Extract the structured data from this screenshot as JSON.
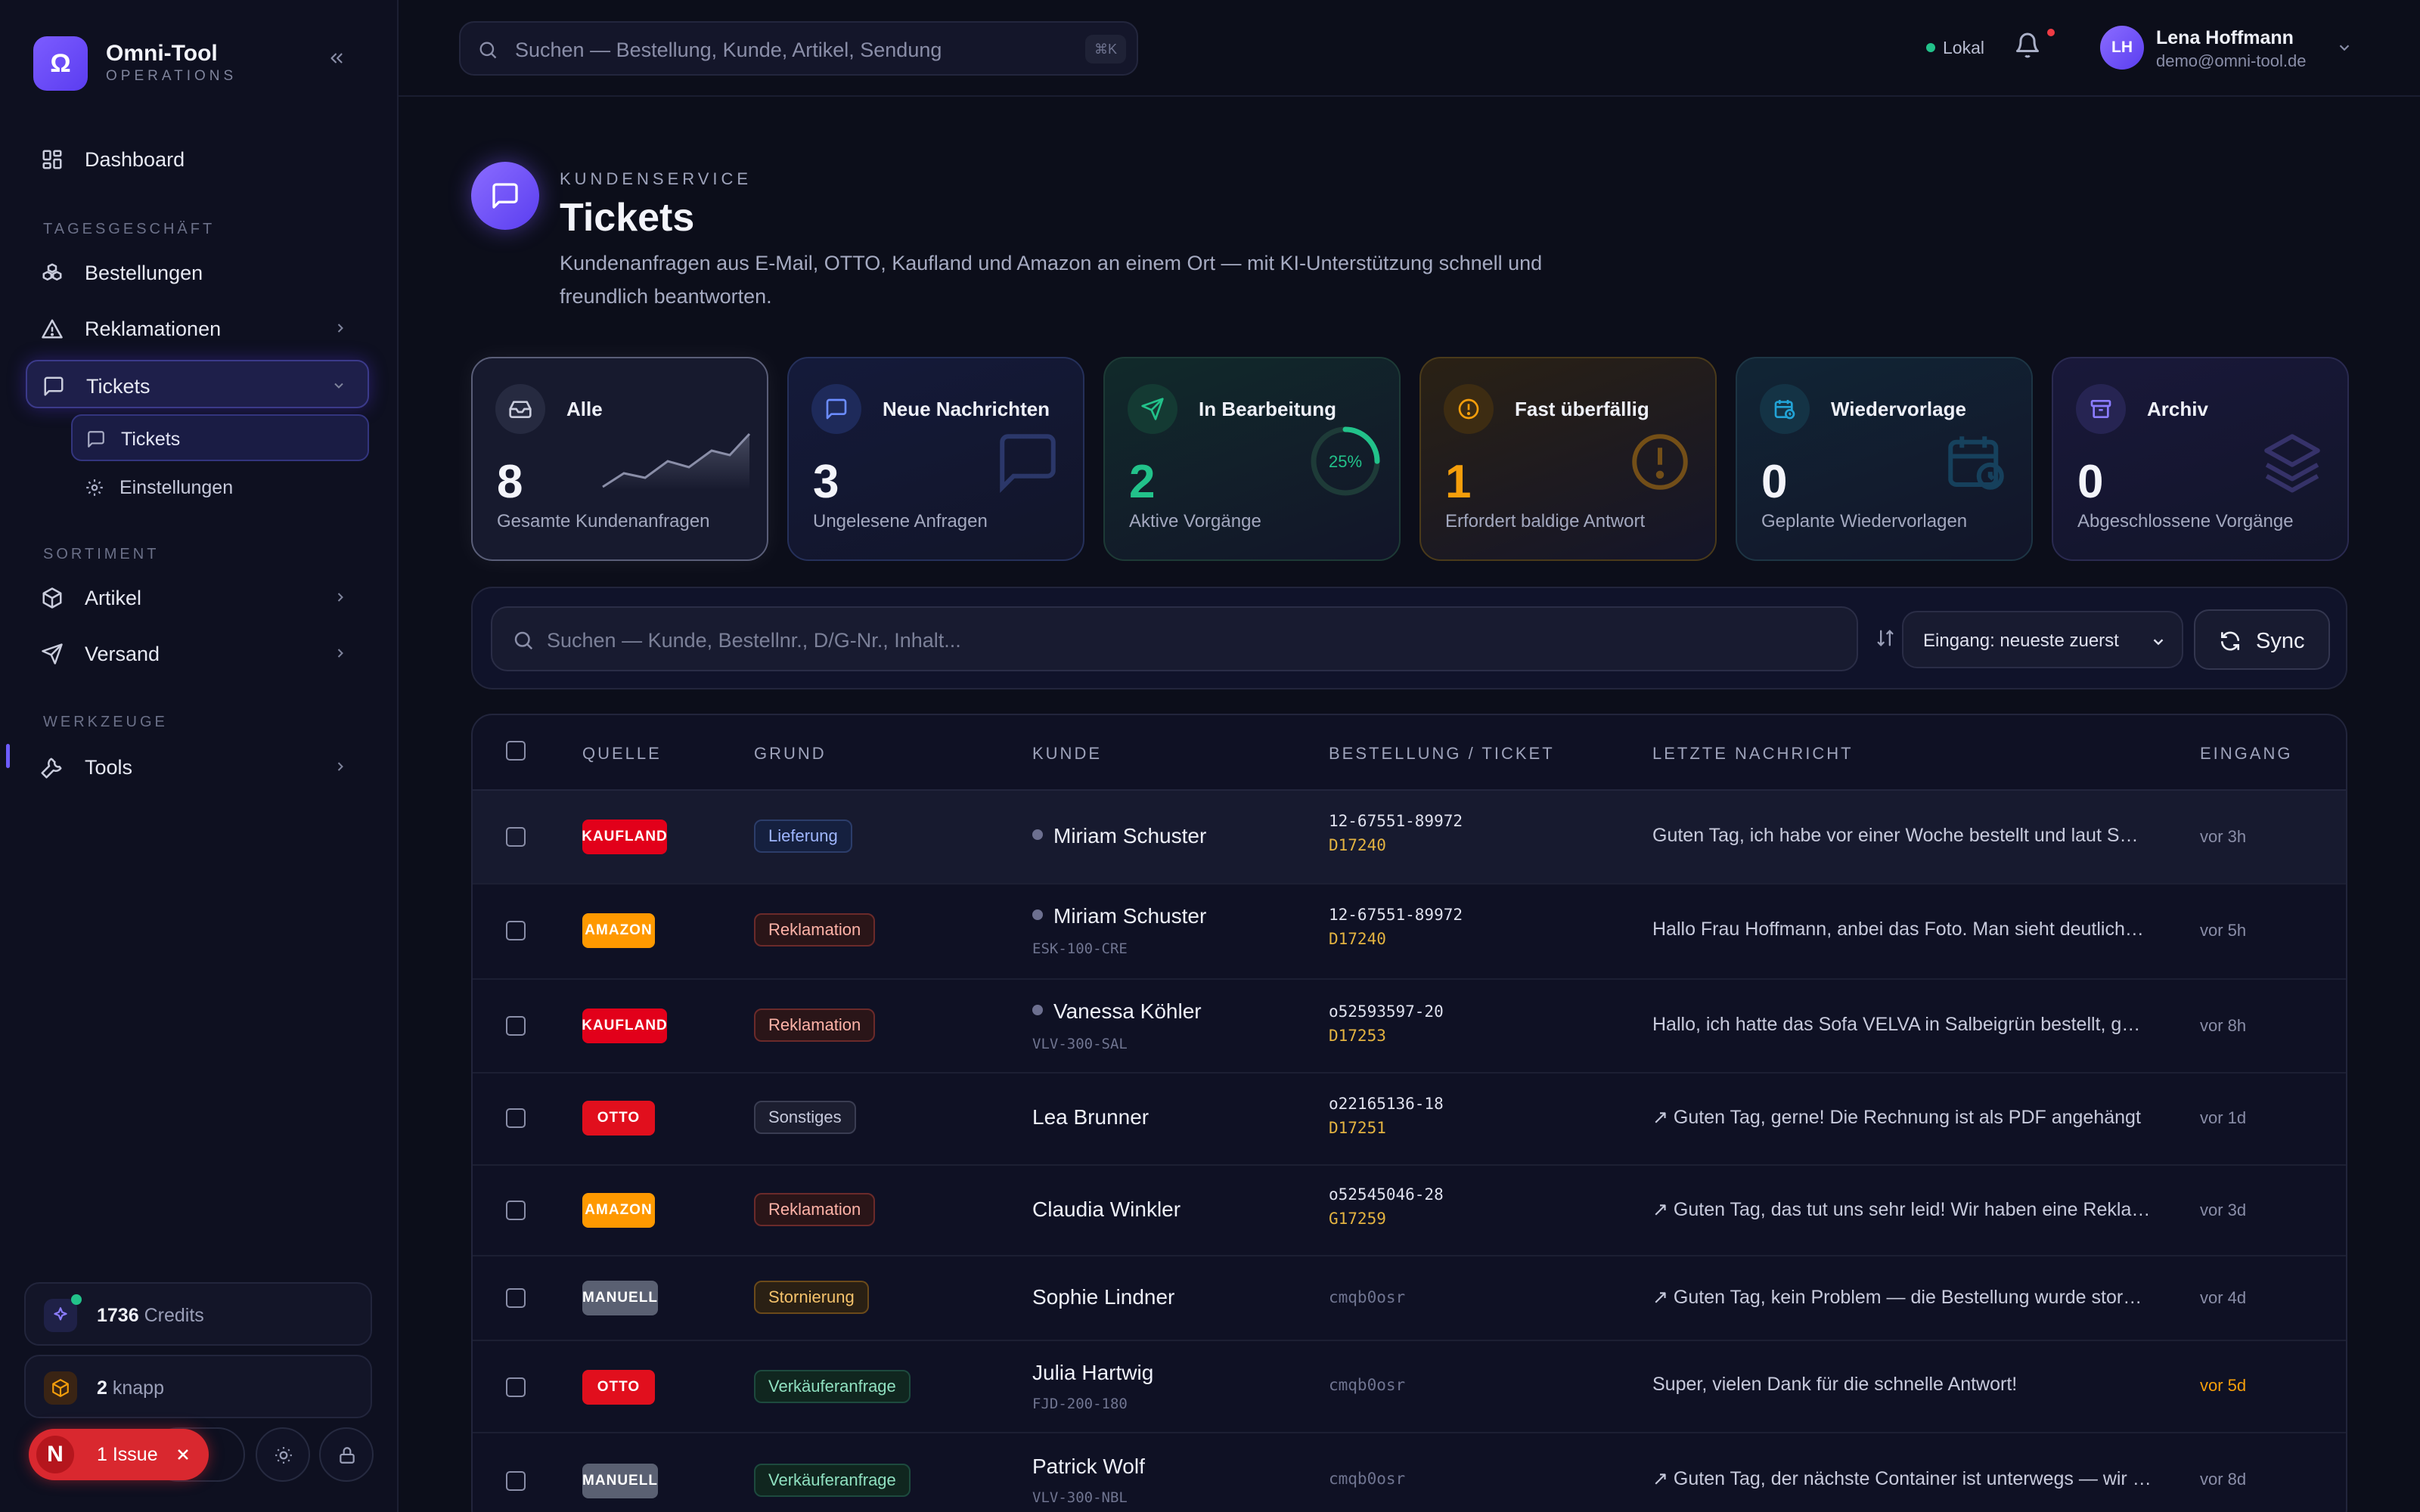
{
  "sidebar": {
    "brand": {
      "logo_glyph": "Ω",
      "name": "Omni-Tool",
      "subtitle": "OPERATIONS"
    },
    "dashboard": "Dashboard",
    "sections": {
      "daily": "TAGESGESCHÄFT",
      "assortment": "SORTIMENT",
      "tools": "WERKZEUGE"
    },
    "items": {
      "orders": "Bestellungen",
      "complaints": "Reklamationen",
      "tickets": "Tickets",
      "tickets_sub": "Tickets",
      "settings_sub": "Einstellungen",
      "articles": "Artikel",
      "shipping": "Versand",
      "tools": "Tools"
    },
    "credits": {
      "value": "1736",
      "unit": "Credits"
    },
    "knapp": {
      "value": "2",
      "unit": "knapp"
    },
    "issue": {
      "glyph": "N",
      "label": "1 Issue"
    }
  },
  "topbar": {
    "search_placeholder": "Suchen — Bestellung, Kunde, Artikel, Sendung",
    "shortcut": "⌘K",
    "status": "Lokal",
    "user": {
      "initials": "LH",
      "name": "Lena Hoffmann",
      "email": "demo@omni-tool.de"
    }
  },
  "page": {
    "eyebrow": "KUNDENSERVICE",
    "title": "Tickets",
    "description": "Kundenanfragen aus E-Mail, OTTO, Kaufland und Amazon an einem Ort — mit KI-Unterstützung schnell und freundlich beantworten."
  },
  "cards": [
    {
      "title": "Alle",
      "value": "8",
      "sub": "Gesamte Kundenanfragen",
      "icon": "inbox-icon",
      "color": "#c9ccdc"
    },
    {
      "title": "Neue Nachrichten",
      "value": "3",
      "sub": "Ungelesene Anfragen",
      "icon": "message-icon",
      "color": "#6b8cff"
    },
    {
      "title": "In Bearbeitung",
      "value": "2",
      "sub": "Aktive Vorgänge",
      "icon": "send-icon",
      "color": "#22c28a",
      "progress_label": "25%",
      "progress": 0.25
    },
    {
      "title": "Fast überfällig",
      "value": "1",
      "sub": "Erfordert baldige Antwort",
      "icon": "alert-circle-icon",
      "color": "#f59e0b"
    },
    {
      "title": "Wiedervorlage",
      "value": "0",
      "sub": "Geplante Wiedervorlagen",
      "icon": "calendar-clock-icon",
      "color": "#22a3d6"
    },
    {
      "title": "Archiv",
      "value": "0",
      "sub": "Abgeschlossene Vorgänge",
      "icon": "archive-icon",
      "color": "#8b7cff"
    }
  ],
  "toolbar": {
    "search_placeholder": "Suchen — Kunde, Bestellnr., D/G-Nr., Inhalt...",
    "sort_value": "Eingang: neueste zuerst",
    "sync_label": "Sync"
  },
  "table": {
    "headers": {
      "source": "QUELLE",
      "reason": "GRUND",
      "customer": "KUNDE",
      "order": "BESTELLUNG / TICKET",
      "message": "LETZTE NACHRICHT",
      "received": "EINGANG"
    },
    "rows": [
      {
        "source": "KAUFLAND",
        "reason": "Lieferung",
        "customer": "Miriam Schuster",
        "sku": "",
        "order": "12-67551-89972",
        "ticket": "D17240",
        "message": "Guten Tag, ich habe vor einer Woche bestellt und laut Sendungsverfolgung",
        "time": "vor 3h"
      },
      {
        "source": "AMAZON",
        "reason": "Reklamation",
        "customer": "Miriam Schuster",
        "sku": "ESK-100-CRE",
        "order": "12-67551-89972",
        "ticket": "D17240",
        "message": "Hallo Frau Hoffmann, anbei das Foto. Man sieht deutlich, dass",
        "time": "vor 5h"
      },
      {
        "source": "KAUFLAND",
        "reason": "Reklamation",
        "customer": "Vanessa Köhler",
        "sku": "VLV-300-SAL",
        "order": "o52593597-20",
        "ticket": "D17253",
        "message": "Hallo, ich hatte das Sofa VELVA in Salbeigrün bestellt, geliefert",
        "time": "vor 8h"
      },
      {
        "source": "OTTO",
        "reason": "Sonstiges",
        "customer": "Lea Brunner",
        "sku": "",
        "order": "o22165136-18",
        "ticket": "D17251",
        "message": "Guten Tag, gerne! Die Rechnung ist als PDF angehängt",
        "time": "vor 1d"
      },
      {
        "source": "AMAZON",
        "reason": "Reklamation",
        "customer": "Claudia Winkler",
        "sku": "",
        "order": "o52545046-28",
        "ticket": "G17259",
        "message": "Guten Tag, das tut uns sehr leid! Wir haben eine Reklamation",
        "time": "vor 3d"
      },
      {
        "source": "MANUELL",
        "reason": "Stornierung",
        "customer": "Sophie Lindner",
        "sku": "",
        "order": "",
        "ticket": "",
        "id": "cmqb0osr",
        "message": "Guten Tag, kein Problem — die Bestellung wurde storniert",
        "time": "vor 4d"
      },
      {
        "source": "OTTO",
        "reason": "Verkäuferanfrage",
        "customer": "Julia Hartwig",
        "sku": "FJD-200-180",
        "order": "",
        "ticket": "",
        "id": "cmqb0osr",
        "message": "Super, vielen Dank für die schnelle Antwort!",
        "time": "vor 5d"
      },
      {
        "source": "MANUELL",
        "reason": "Verkäuferanfrage",
        "customer": "Patrick Wolf",
        "sku": "VLV-300-NBL",
        "order": "",
        "ticket": "",
        "id": "cmqb0osr",
        "message": "Guten Tag, der nächste Container ist unterwegs — wir melden",
        "time": "vor 8d"
      }
    ]
  },
  "colors": {
    "accent": "#6d5cff",
    "kaufland": "#e2001a",
    "amazon": "#ff9900",
    "otto": "#e10f1d",
    "manuell": "#5a6072",
    "warning": "#f59e0b"
  }
}
